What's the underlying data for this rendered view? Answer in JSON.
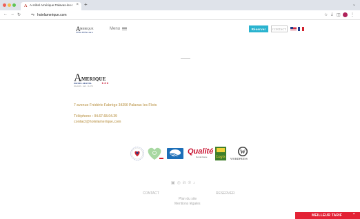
{
  "browser": {
    "tab_title": "A-Hôtel Amérique Palavas-les-Flots",
    "tab_close": "×",
    "new_tab": "+",
    "url": "hotelamerique.com"
  },
  "header": {
    "logo_initial": "A",
    "logo_word": "MERIQUE",
    "logo_sub": "HOTEL MOTEL ★★★",
    "menu_label": "Menu",
    "reserve_label": "Réserver",
    "contact_label": "CONTACT",
    "languages": [
      "en",
      "fr"
    ]
  },
  "hotel_logo": {
    "initial": "A",
    "word": "MERIQUE",
    "line": "HOTEL MOTEL",
    "stars": "★★★",
    "tag": "PALAVAS · LES · FLOTS"
  },
  "contact_info": {
    "address": "7 avenue Frédéric Fabrège 34250 Palavas les Flots",
    "phone": "Téléphone : 04.67.68.04.39",
    "email": "contact@hotelamerique.com"
  },
  "labels": {
    "qualite_text": "Qualité",
    "qualite_sub": "Sud de France",
    "wordpress_text": "WORDPRESS",
    "logis_text": "Logis"
  },
  "socials": [
    "facebook-icon",
    "instagram-icon",
    "linkedin-icon",
    "pinterest-icon",
    "tiktok-icon"
  ],
  "footer": {
    "contact": "CONTACT",
    "reserver": "RESERVER",
    "plan": "Plan du site",
    "mentions": "Mentions légales"
  },
  "best_rate": {
    "label": "MEILLEUR TARIF"
  },
  "colors": {
    "accent_gold": "#c8a96b",
    "reserve_blue": "#2ab3cf",
    "best_rate_red": "#e32235"
  }
}
